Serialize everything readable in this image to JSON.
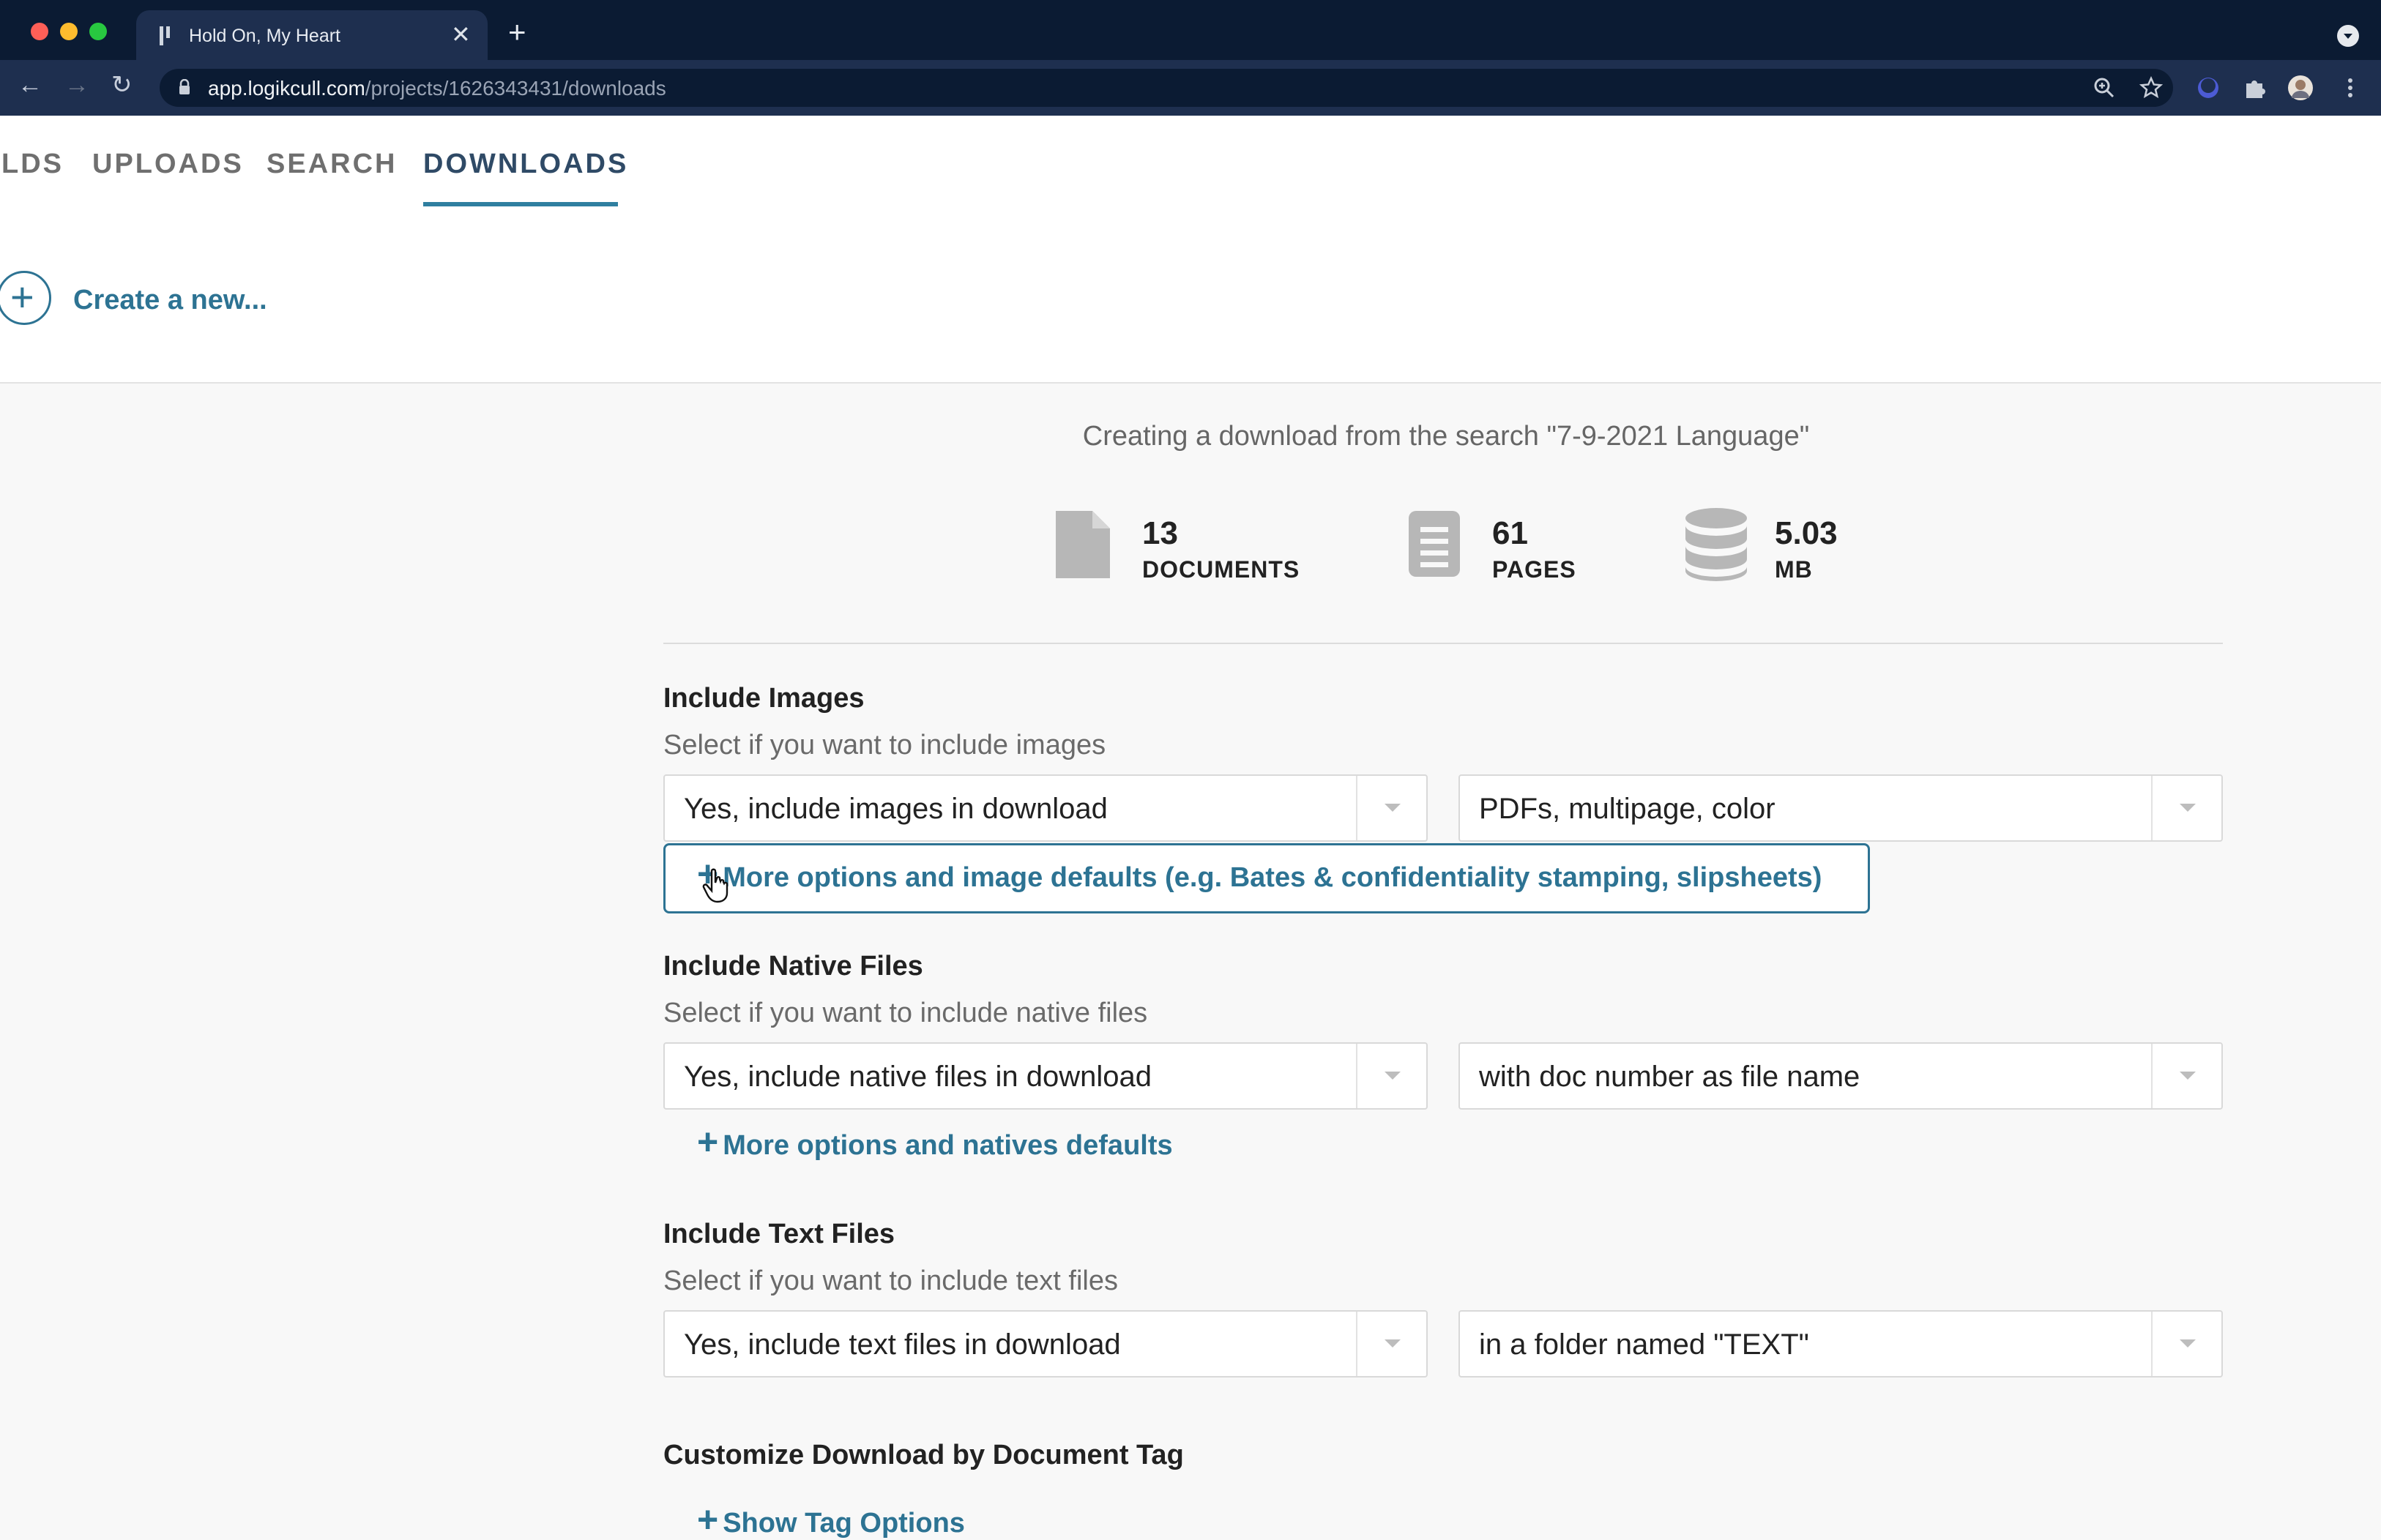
{
  "browser": {
    "tab_title": "Hold On, My Heart",
    "tab_close": "✕",
    "new_tab": "+",
    "url_host": "app.logikcull.com",
    "url_path": "/projects/1626343431/downloads",
    "back": "←",
    "forward": "→",
    "reload": "↻"
  },
  "nav": {
    "tabs": [
      {
        "label": "LDS"
      },
      {
        "label": "UPLOADS"
      },
      {
        "label": "SEARCH"
      },
      {
        "label": "DOWNLOADS",
        "active": true
      }
    ]
  },
  "create": {
    "plus": "+",
    "label": "Create a new..."
  },
  "download": {
    "subtitle": "Creating a download from the search \"7-9-2021 Language\"",
    "stats": [
      {
        "icon": "document-icon",
        "value": "13",
        "label": "DOCUMENTS"
      },
      {
        "icon": "pages-icon",
        "value": "61",
        "label": "PAGES"
      },
      {
        "icon": "database-icon",
        "value": "5.03",
        "label": "MB"
      }
    ]
  },
  "images": {
    "title": "Include Images",
    "subtitle": "Select if you want to include images",
    "select_left": "Yes, include images in download",
    "select_right": "PDFs, multipage, color",
    "more": "More options and image defaults (e.g. Bates & confidentiality stamping, slipsheets)"
  },
  "natives": {
    "title": "Include Native Files",
    "subtitle": "Select if you want to include native files",
    "select_left": "Yes, include native files in download",
    "select_right": "with doc number as file name",
    "more": "More options and natives defaults"
  },
  "text": {
    "title": "Include Text Files",
    "subtitle": "Select if you want to include text files",
    "select_left": "Yes, include text files in download",
    "select_right": "in a folder named \"TEXT\""
  },
  "tags": {
    "title": "Customize Download by Document Tag",
    "more": "Show Tag Options"
  },
  "plus_glyph": "+",
  "colors": {
    "accent": "#2d7393",
    "chrome_dark": "#0b1b33",
    "chrome_tab": "#1e2f4f",
    "page_bg": "#f8f8f8"
  }
}
